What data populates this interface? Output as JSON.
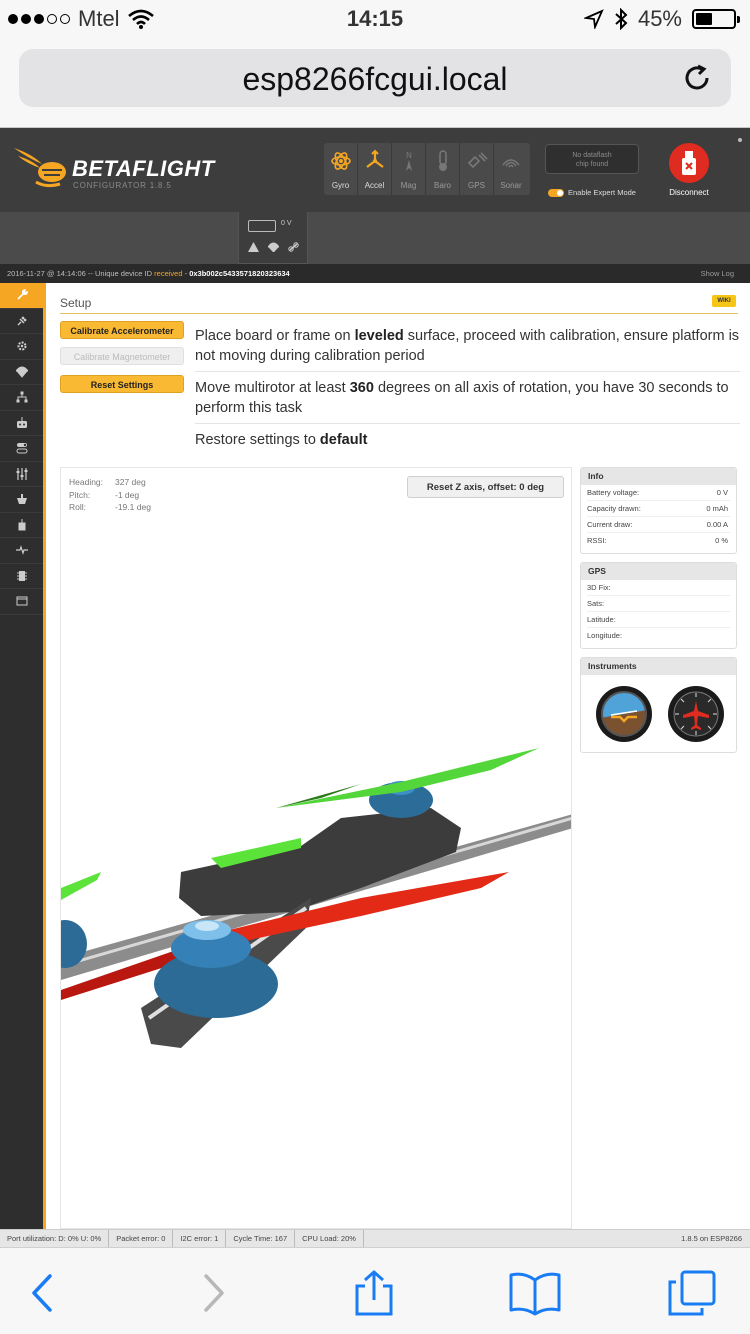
{
  "status_bar": {
    "carrier": "Mtel",
    "time": "14:15",
    "battery": "45%"
  },
  "browser": {
    "url": "esp8266fcgui.local"
  },
  "header": {
    "brand": "BETAFLIGHT",
    "subtitle": "CONFIGURATOR  1.8.5",
    "sensors": [
      {
        "label": "Gyro",
        "icon": "gyro-icon",
        "active": true
      },
      {
        "label": "Accel",
        "icon": "accel-icon",
        "active": true
      },
      {
        "label": "Mag",
        "icon": "mag-icon",
        "active": false
      },
      {
        "label": "Baro",
        "icon": "baro-icon",
        "active": false
      },
      {
        "label": "GPS",
        "icon": "gps-icon",
        "active": false
      },
      {
        "label": "Sonar",
        "icon": "sonar-icon",
        "active": false
      }
    ],
    "mag_letter": "N",
    "flash_line1": "No dataflash",
    "flash_line2": "chip found",
    "expert_mode": "Enable Expert Mode",
    "disconnect": "Disconnect",
    "accent_color": "#f5a623",
    "disconnect_color": "#e02b20"
  },
  "battery_widget": {
    "voltage": "0 V"
  },
  "log": {
    "prefix": "2016-11-27 @ 14:14:06 -- Unique device ID ",
    "received": "received",
    "separator": " - ",
    "device_id": "0x3b002c5433571820323634",
    "show_log": "Show Log"
  },
  "sidebar": {
    "items": [
      {
        "icon": "wrench-icon",
        "active": true
      },
      {
        "icon": "plug-icon"
      },
      {
        "icon": "gear-icon"
      },
      {
        "icon": "parachute-icon"
      },
      {
        "icon": "network-icon"
      },
      {
        "icon": "receiver-icon"
      },
      {
        "icon": "toggle-icon"
      },
      {
        "icon": "sliders-icon"
      },
      {
        "icon": "motor-icon"
      },
      {
        "icon": "led-icon"
      },
      {
        "icon": "sensor-pulse-icon"
      },
      {
        "icon": "dataflash-icon"
      },
      {
        "icon": "cli-icon"
      }
    ]
  },
  "setup": {
    "title": "Setup",
    "wiki": "WIKI",
    "buttons": {
      "calibrate_acc": "Calibrate Accelerometer",
      "calibrate_mag": "Calibrate Magnetometer",
      "reset": "Reset Settings"
    },
    "desc1_a": "Place board or frame on ",
    "desc1_b": "leveled",
    "desc1_c": " surface, proceed with calibration, ensure platform is not moving during calibration period",
    "desc2_a": "Move multirotor at least ",
    "desc2_b": "360",
    "desc2_c": " degrees on all axis of rotation, you have 30 seconds to perform this task",
    "desc3_a": "Restore settings to ",
    "desc3_b": "default"
  },
  "attitude": {
    "heading_label": "Heading:",
    "heading": "327 deg",
    "pitch_label": "Pitch:",
    "pitch": "-1 deg",
    "roll_label": "Roll:",
    "roll": "-19.1 deg",
    "reset_z": "Reset Z axis, offset: 0 deg"
  },
  "info": {
    "title": "Info",
    "rows": [
      {
        "label": "Battery voltage:",
        "value": "0 V"
      },
      {
        "label": "Capacity drawn:",
        "value": "0 mAh"
      },
      {
        "label": "Current draw:",
        "value": "0.00 A"
      },
      {
        "label": "RSSI:",
        "value": "0 %"
      }
    ]
  },
  "gps": {
    "title": "GPS",
    "rows": [
      {
        "label": "3D Fix:"
      },
      {
        "label": "Sats:"
      },
      {
        "label": "Latitude:"
      },
      {
        "label": "Longitude:"
      }
    ]
  },
  "instruments": {
    "title": "Instruments"
  },
  "footer": {
    "port": "Port utilization: D: 0% U: 0%",
    "packet": "Packet error: 0",
    "i2c": "I2C error: 1",
    "cycle": "Cycle Time: 167",
    "cpu": "CPU Load: 20%",
    "version": "1.8.5 on ESP8266"
  }
}
